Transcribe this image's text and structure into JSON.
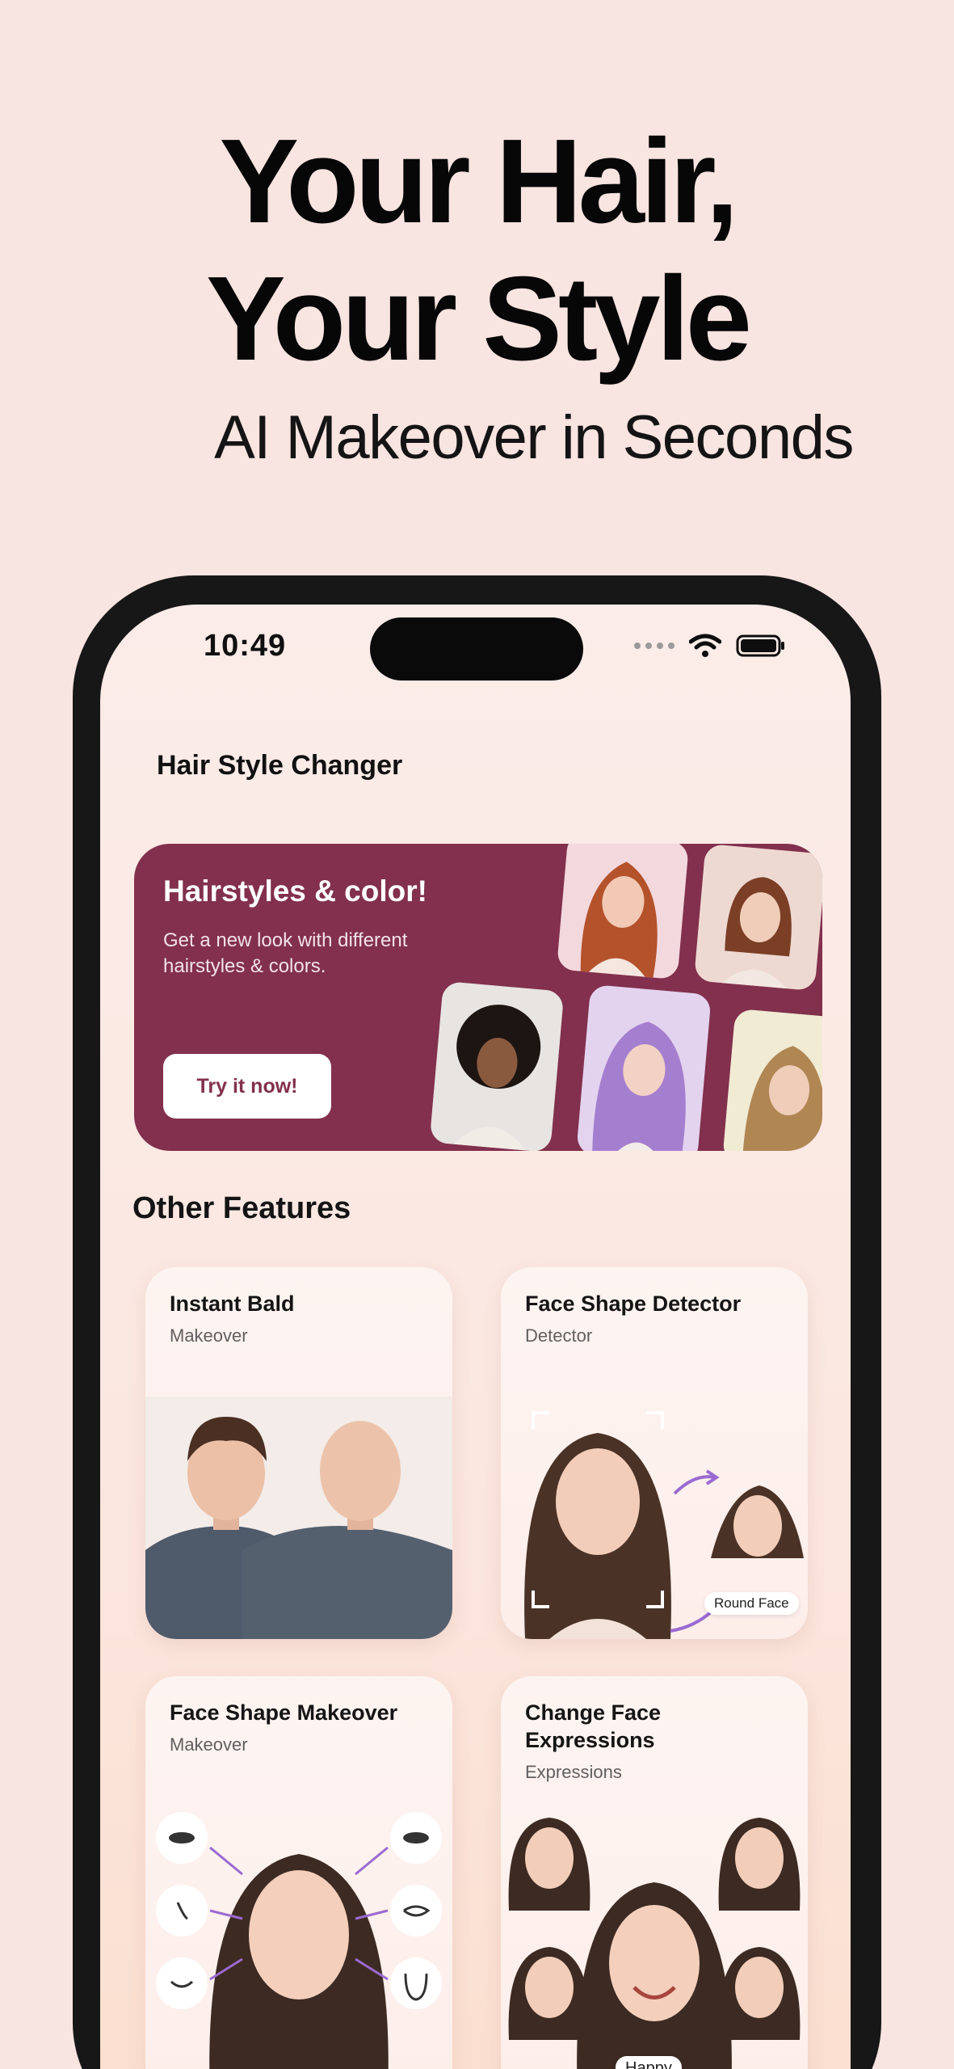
{
  "hero": {
    "title_line1": "Your Hair,",
    "title_line2": "Your Style",
    "subtitle": "AI Makeover in Seconds"
  },
  "status_bar": {
    "time": "10:49"
  },
  "app": {
    "title": "Hair Style Changer"
  },
  "banner": {
    "title": "Hairstyles & color!",
    "description": "Get a new look with different hairstyles & colors.",
    "button_label": "Try it now!",
    "background_color": "#82304d"
  },
  "features": {
    "section_title": "Other Features",
    "cards": [
      {
        "title": "Instant Bald",
        "subtitle": "Makeover"
      },
      {
        "title": "Face Shape Detector",
        "subtitle": "Detector",
        "badge": "Round Face"
      },
      {
        "title": "Face Shape Makeover",
        "subtitle": "Makeover"
      },
      {
        "title": "Change Face Expressions",
        "subtitle": "Expressions",
        "badge": "Happy"
      }
    ]
  }
}
